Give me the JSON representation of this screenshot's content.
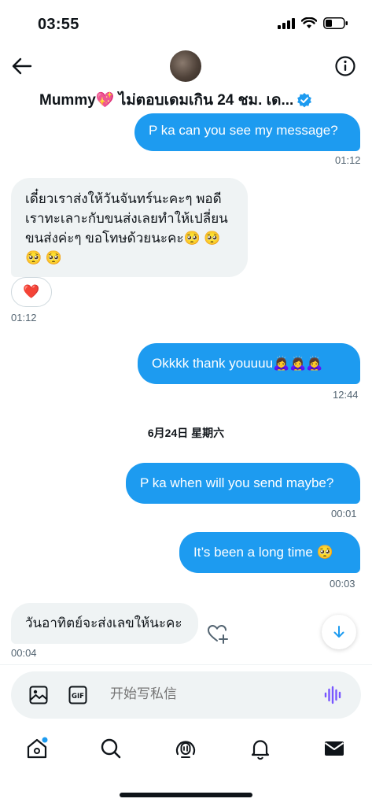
{
  "status_bar": {
    "time": "03:55"
  },
  "header": {
    "contact_name": "Mummy💖 ไม่ตอบเดมเกิน 24 ชม. เด...",
    "verified_icon": "verified-badge-icon",
    "back_icon": "arrow-left-icon",
    "info_icon": "info-icon"
  },
  "messages": [
    {
      "dir": "out",
      "text": "P ka can you see my message?",
      "time": "01:12"
    },
    {
      "dir": "in",
      "text": "เดี๋ยวเราส่งให้วันจันทร์นะคะๆ พอดีเราทะเลาะกับขนส่งเลยทำให้เปลี่ยนขนส่งค่ะๆ ขอโทษด้วยนะคะ🥺 🥺 🥺 🥺",
      "reaction": "❤️",
      "time": "01:12"
    },
    {
      "dir": "out",
      "text": "Okkkk thank youuuu🙇‍♀️🙇‍♀️🙇‍♀️",
      "time": "12:44"
    },
    {
      "date_separator": "6月24日 星期六"
    },
    {
      "dir": "out",
      "text": "P ka when will you send maybe?",
      "time": "00:01"
    },
    {
      "dir": "out",
      "text": "It’s been a long time 🥺",
      "time": "00:03"
    },
    {
      "dir": "in",
      "text": "วันอาทิตย์จะส่งเลขให้นะคะ",
      "time": "00:04"
    }
  ],
  "composer": {
    "placeholder": "开始写私信",
    "image_icon": "image-icon",
    "gif_icon": "gif-icon",
    "voice_icon": "voice-waveform-icon"
  },
  "tabbar": [
    "home-icon",
    "search-icon",
    "spaces-icon",
    "notifications-icon",
    "messages-icon"
  ],
  "colors": {
    "accent": "#1d9bf0",
    "incoming_bubble": "#eff3f4",
    "text": "#0f1419",
    "muted": "#536471"
  }
}
